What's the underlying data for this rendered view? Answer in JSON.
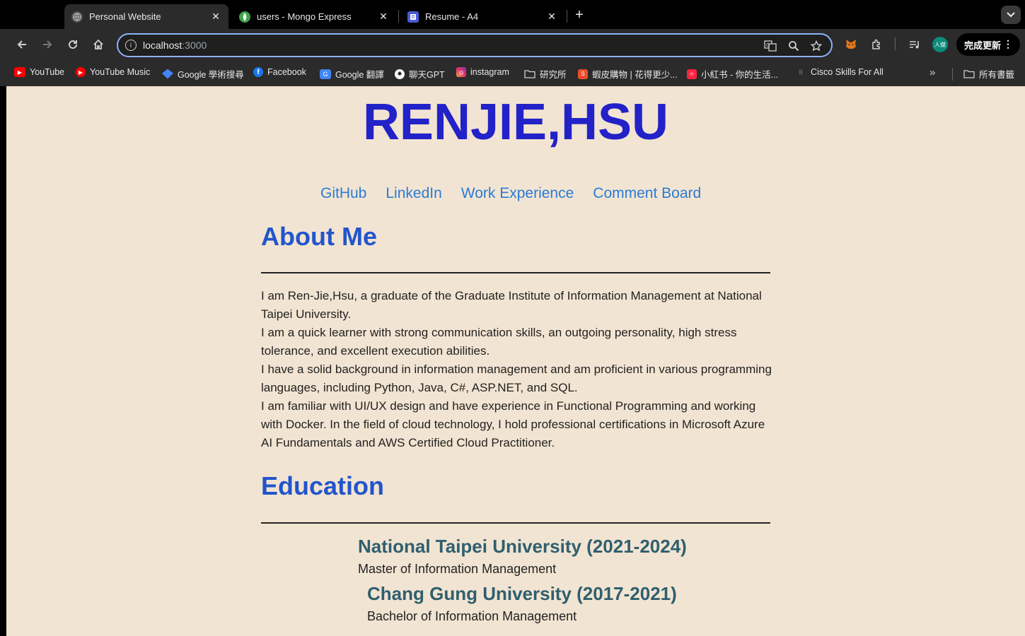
{
  "browser": {
    "tabs": [
      {
        "title": "Personal Website",
        "active": true
      },
      {
        "title": "users - Mongo Express",
        "active": false
      },
      {
        "title": "Resume - A4",
        "active": false
      }
    ],
    "url_host": "localhost",
    "url_port": ":3000",
    "profile_label": "人傑",
    "update_label": "完成更新",
    "bookmarks": [
      {
        "label": "YouTube",
        "icon": "youtube-icon"
      },
      {
        "label": "YouTube Music",
        "icon": "youtube-music-icon"
      },
      {
        "label": "Google 學術搜尋",
        "icon": "scholar-icon"
      },
      {
        "label": "Facebook",
        "icon": "facebook-icon"
      },
      {
        "label": "Google 翻譯",
        "icon": "translate-icon"
      },
      {
        "label": "聊天GPT",
        "icon": "chatgpt-icon"
      },
      {
        "label": "instagram",
        "icon": "instagram-icon"
      },
      {
        "label": "研究所",
        "icon": "folder-icon"
      },
      {
        "label": "蝦皮購物 | 花得更少...",
        "icon": "shopee-icon"
      },
      {
        "label": "小紅书 - 你的生活...",
        "icon": "xiaohongshu-icon"
      },
      {
        "label": "Cisco Skills For All",
        "icon": "cisco-icon"
      }
    ],
    "all_bookmarks_label": "所有書籤"
  },
  "page": {
    "name": "RENJIE,HSU",
    "nav": [
      "GitHub",
      "LinkedIn",
      "Work Experience",
      "Comment Board"
    ],
    "about_title": "About Me",
    "about_paragraphs": [
      "I am Ren-Jie,Hsu, a graduate of the Graduate Institute of Information Management at National Taipei University.",
      "I am a quick learner with strong communication skills, an outgoing personality, high stress tolerance, and excellent execution abilities.",
      "I have a solid background in information management and am proficient in various programming languages, including Python, Java, C#, ASP.NET, and SQL.",
      "I am familiar with UI/UX design and have experience in Functional Programming and working with Docker. In the field of cloud technology, I hold professional certifications in Microsoft Azure AI Fundamentals and AWS Certified Cloud Practitioner."
    ],
    "education_title": "Education",
    "education": [
      {
        "school": "National Taipei University (2021-2024)",
        "degree": "Master of Information Management"
      },
      {
        "school": "Chang Gung University (2017-2021)",
        "degree": "Bachelor of Information Management"
      }
    ]
  },
  "colors": {
    "page_bg": "#f2e4d2",
    "name": "#2222c8",
    "section_title": "#2255cc",
    "link": "#2a7bd6",
    "school": "#2f5f6f"
  }
}
